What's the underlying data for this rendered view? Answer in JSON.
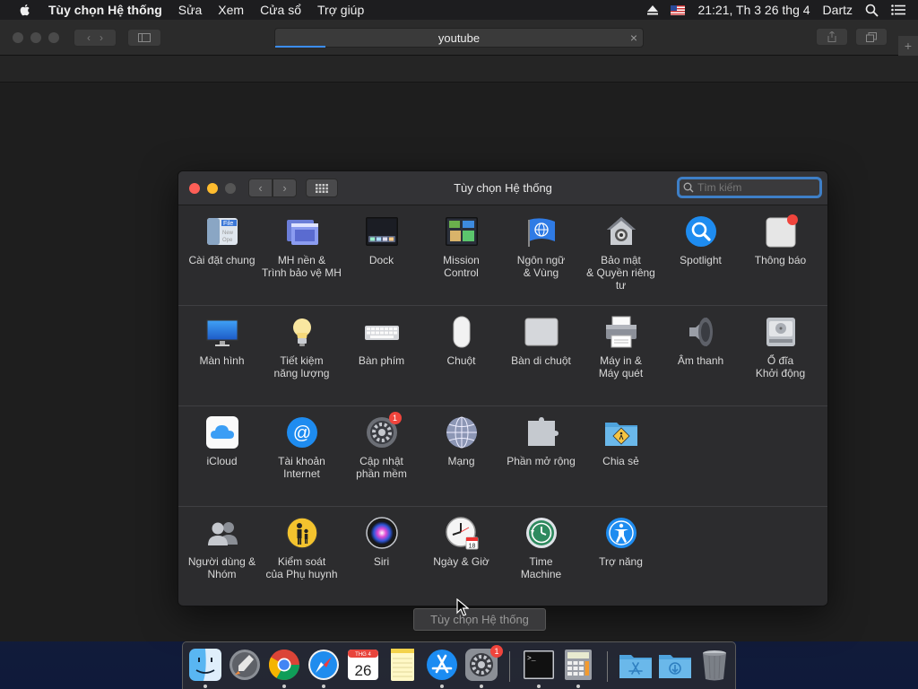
{
  "menubar": {
    "app_name": "Tùy chọn Hệ thống",
    "items": [
      "Sửa",
      "Xem",
      "Cửa sổ",
      "Trợ giúp"
    ],
    "clock": "21:21, Th 3 26 thg 4",
    "user": "Dartz"
  },
  "browser": {
    "url_text": "youtube"
  },
  "syspref": {
    "title": "Tùy chọn Hệ thống",
    "search_placeholder": "Tìm kiếm",
    "rows": [
      [
        {
          "label": "Cài đặt chung",
          "icon": "general-icon"
        },
        {
          "label": "MH nền &\nTrình bảo vệ MH",
          "icon": "desktop-screensaver-icon"
        },
        {
          "label": "Dock",
          "icon": "dock-icon"
        },
        {
          "label": "Mission\nControl",
          "icon": "mission-control-icon"
        },
        {
          "label": "Ngôn ngữ\n& Vùng",
          "icon": "language-region-icon"
        },
        {
          "label": "Bảo mật\n& Quyền riêng tư",
          "icon": "security-privacy-icon"
        },
        {
          "label": "Spotlight",
          "icon": "spotlight-icon"
        },
        {
          "label": "Thông báo",
          "icon": "notifications-icon"
        }
      ],
      [
        {
          "label": "Màn hình",
          "icon": "displays-icon"
        },
        {
          "label": "Tiết kiệm\nnăng lượng",
          "icon": "energy-saver-icon"
        },
        {
          "label": "Bàn phím",
          "icon": "keyboard-icon"
        },
        {
          "label": "Chuột",
          "icon": "mouse-icon"
        },
        {
          "label": "Bàn di chuột",
          "icon": "trackpad-icon"
        },
        {
          "label": "Máy in &\nMáy quét",
          "icon": "printers-scanners-icon"
        },
        {
          "label": "Âm thanh",
          "icon": "sound-icon"
        },
        {
          "label": "Ổ đĩa\nKhởi động",
          "icon": "startup-disk-icon"
        }
      ],
      [
        {
          "label": "iCloud",
          "icon": "icloud-icon"
        },
        {
          "label": "Tài khoản\nInternet",
          "icon": "internet-accounts-icon"
        },
        {
          "label": "Cập nhật\nphần mềm",
          "icon": "software-update-icon",
          "badge": "1"
        },
        {
          "label": "Mạng",
          "icon": "network-icon"
        },
        {
          "label": "Phần mở rộng",
          "icon": "extensions-icon"
        },
        {
          "label": "Chia sẻ",
          "icon": "sharing-icon"
        }
      ],
      [
        {
          "label": "Người dùng &\nNhóm",
          "icon": "users-groups-icon"
        },
        {
          "label": "Kiểm soát\ncủa Phụ huynh",
          "icon": "parental-controls-icon"
        },
        {
          "label": "Siri",
          "icon": "siri-icon"
        },
        {
          "label": "Ngày & Giờ",
          "icon": "date-time-icon"
        },
        {
          "label": "Time\nMachine",
          "icon": "time-machine-icon"
        },
        {
          "label": "Trợ năng",
          "icon": "accessibility-icon"
        }
      ]
    ]
  },
  "tooltip": "Tùy chọn Hệ thống",
  "dock": {
    "calendar_month": "THG 4",
    "calendar_day": "26",
    "syspref_badge": "1",
    "items": [
      "finder-icon",
      "launchpad-icon",
      "chrome-icon",
      "safari-icon",
      "calendar-icon",
      "notes-icon",
      "app-store-icon",
      "system-preferences-icon",
      "terminal-icon",
      "calculator-icon",
      "applications-folder-icon",
      "downloads-folder-icon",
      "trash-icon"
    ]
  }
}
